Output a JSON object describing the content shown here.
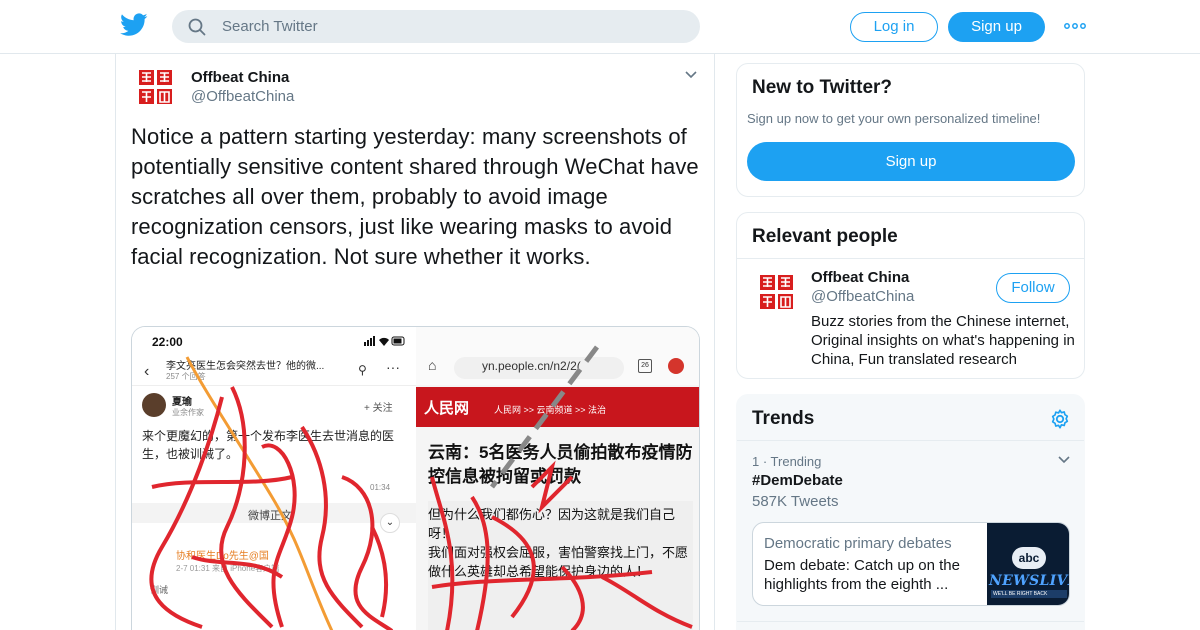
{
  "header": {
    "search_placeholder": "Search Twitter",
    "login_label": "Log in",
    "signup_label": "Sign up"
  },
  "tweet": {
    "author_name": "Offbeat China",
    "author_handle": "@OffbeatChina",
    "avatar_text": "奇怪中国",
    "text": "Notice a pattern starting yesterday: many screenshots of potentially sensitive content shared through WeChat have scratches all over them, probably to avoid image recognization censors, just like wearing masks to avoid facial recognization. Not sure whether it works.",
    "media": {
      "left": {
        "time": "22:00",
        "title": "李文亮医生怎会突然去世？他的微...",
        "subtitle": "257 个回答",
        "user": "夏瑜",
        "user_tag": "业余作家",
        "follow": "+ 关注",
        "body": "来个更魔幻的，第一个发布李医生去世消息的医生，也被训诫了。",
        "bar_label": "微博正文",
        "timestamp": "01:34",
        "cite": "协和医生Do先生@国",
        "meta": "2-7 01:31 来自 iPhone客户端",
        "footer": "训诫"
      },
      "right": {
        "url": "yn.people.cn/n2/2(",
        "tab_count": "26",
        "site_logo": "人民网",
        "breadcrumb": "人民网 >> 云南频道 >> 法治",
        "headline": "云南：5名医务人员偷拍散布疫情防控信息被拘留或罚款",
        "body": "但为什么我们都伤心？因为这就是我们自己呀！\n我们面对强权会屈服，害怕警察找上门，不愿做什么英雄却总希望能保护身边的人！"
      }
    }
  },
  "new_to_twitter": {
    "title": "New to Twitter?",
    "subtitle": "Sign up now to get your own personalized timeline!",
    "signup_label": "Sign up"
  },
  "relevant_people": {
    "title": "Relevant people",
    "name": "Offbeat China",
    "handle": "@OffbeatChina",
    "follow_label": "Follow",
    "bio": "Buzz stories from the Chinese internet, Original insights on what's happening in China, Fun translated research"
  },
  "trends": {
    "title": "Trends",
    "items": [
      {
        "meta": "1 · Trending",
        "tag": "#DemDebate",
        "count": "587K Tweets",
        "card_topic": "Democratic primary debates",
        "card_headline": "Dem debate: Catch up on the highlights from the eighth ...",
        "thumb_brand": "abc",
        "thumb_title": "NEWSLIVE",
        "thumb_bar": "WE'LL BE RIGHT BACK"
      }
    ]
  },
  "colors": {
    "accent": "#1da1f2",
    "secondary_text": "#657786",
    "border": "#e6ecf0",
    "people_daily_red": "#c8161d",
    "scratch_red": "#e0262e"
  }
}
